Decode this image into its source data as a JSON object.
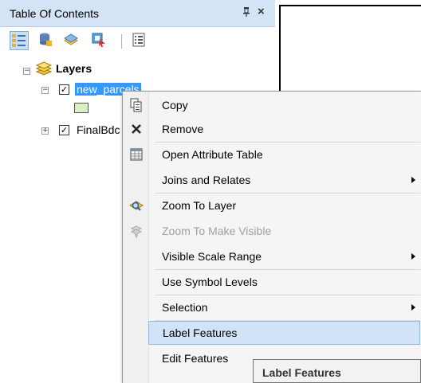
{
  "toc": {
    "title": "Table Of Contents",
    "pin_glyph": "ⱼ",
    "close_glyph": "×"
  },
  "toolbar": {
    "buttons": [
      {
        "icon": "list-by-drawing-order-icon",
        "active": true
      },
      {
        "icon": "list-by-source-icon",
        "active": false
      },
      {
        "icon": "list-by-visibility-icon",
        "active": false
      },
      {
        "icon": "list-by-selection-icon",
        "active": false
      },
      {
        "icon": "options-icon",
        "active": false
      }
    ]
  },
  "tree": {
    "root_label": "Layers",
    "layer1_label": "new_parcels",
    "layer2_label": "FinalBdc",
    "expanded_glyph": "−",
    "collapsed_glyph": "+",
    "check_glyph": "✓",
    "symbol_color": "#d9efc4"
  },
  "context_menu": {
    "items": {
      "copy": "Copy",
      "remove": "Remove",
      "open_attribute_table": "Open Attribute Table",
      "joins_and_relates": "Joins and Relates",
      "zoom_to_layer": "Zoom To Layer",
      "zoom_to_make_visible": "Zoom To Make Visible",
      "visible_scale_range": "Visible Scale Range",
      "use_symbol_levels": "Use Symbol Levels",
      "selection": "Selection",
      "label_features": "Label Features",
      "edit_features": "Edit Features"
    },
    "highlighted": "label_features"
  },
  "tooltip": {
    "text": "Label Features"
  },
  "colors": {
    "title_bar": "#d4e4f6",
    "selection": "#3399ff",
    "menu_highlight": "#d1e3f6",
    "menu_bg": "#f5f5f5"
  }
}
